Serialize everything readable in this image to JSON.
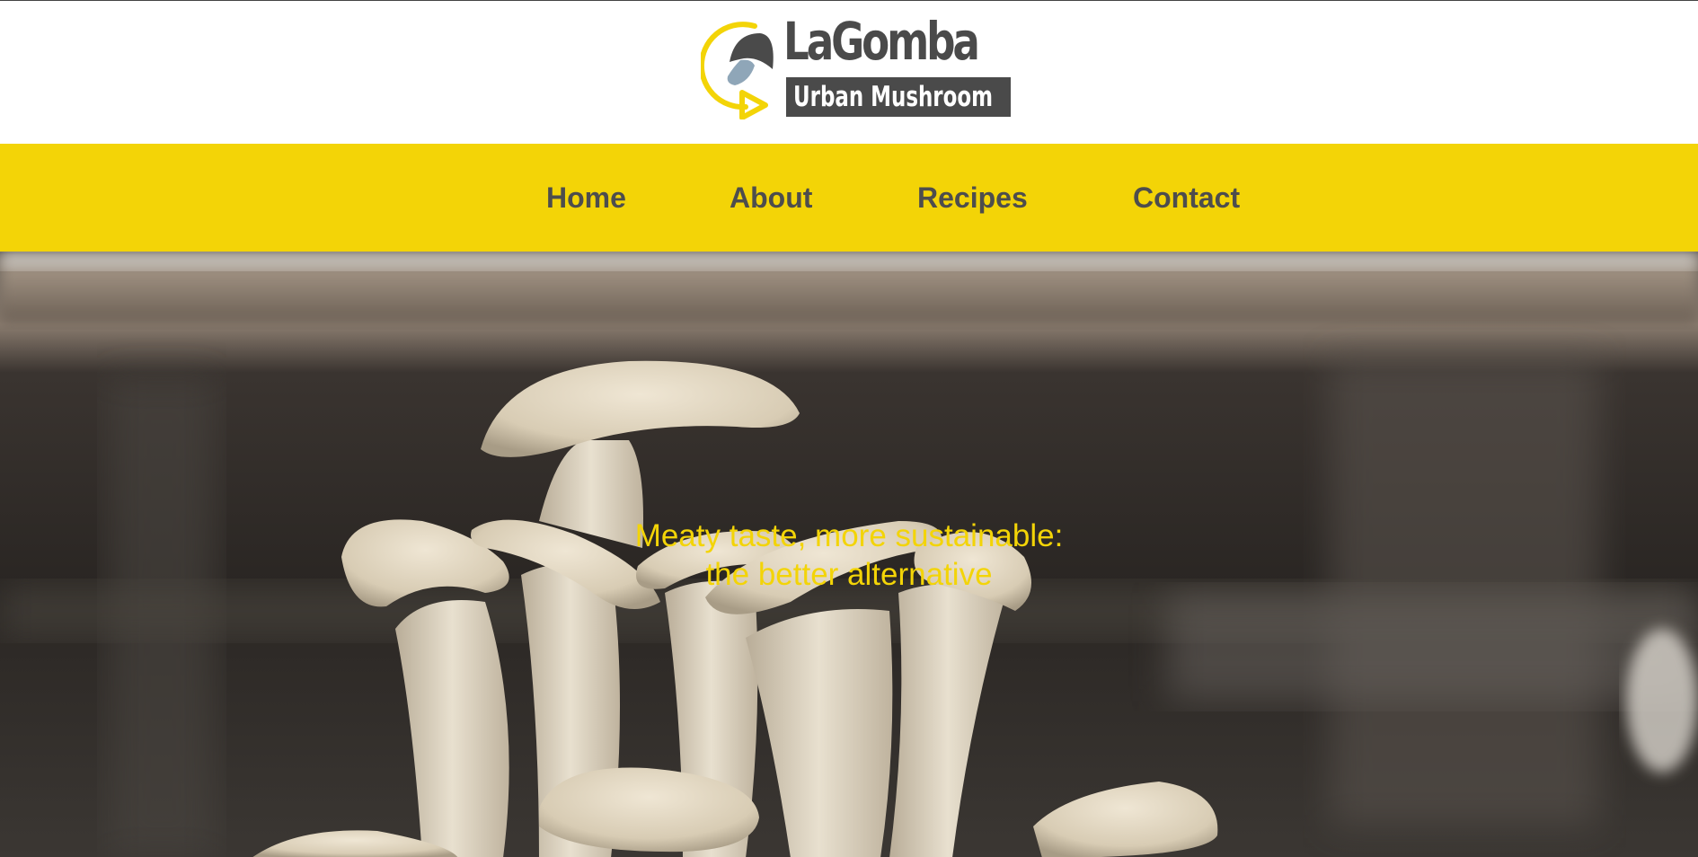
{
  "brand": {
    "name": "LaGomba",
    "subtitle": "Urban Mushroom",
    "logo_icon": "mushroom-circle-arrow-icon",
    "colors": {
      "accent_yellow": "#f3d407",
      "logo_gray": "#4a4a4a",
      "nav_text": "#4d4d4d"
    }
  },
  "nav": {
    "items": [
      {
        "label": "Home"
      },
      {
        "label": "About"
      },
      {
        "label": "Recipes"
      },
      {
        "label": "Contact"
      }
    ]
  },
  "hero": {
    "tagline_line1": "Meaty taste, more sustainable:",
    "tagline_line2": "the better alternative"
  }
}
